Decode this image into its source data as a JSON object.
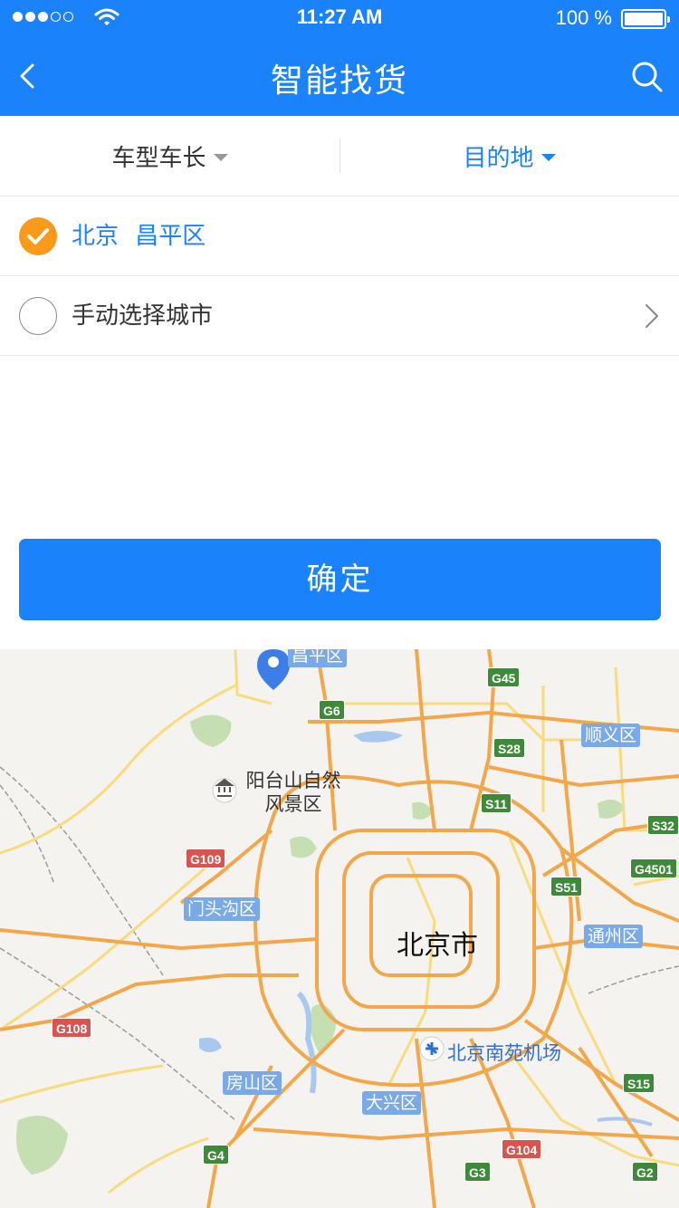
{
  "status_bar": {
    "signal_dots_filled": 3,
    "signal_dots_total": 5,
    "time": "11:27 AM",
    "battery": "100 %",
    "battery_level": 1.0
  },
  "nav": {
    "title": "智能找货",
    "back_icon": "chevron-left-icon",
    "search_icon": "search-icon"
  },
  "filters": {
    "vehicle": "车型车长",
    "destination": "目的地"
  },
  "options": [
    {
      "label": "北京 昌平区",
      "checked": true
    },
    {
      "label": "手动选择城市",
      "checked": false
    }
  ],
  "confirm_label": "确定",
  "map": {
    "districts": [
      "昌平区",
      "顺义区",
      "门头沟区",
      "通州区",
      "房山区",
      "大兴区"
    ],
    "city": "北京市",
    "poi_park": "阳台山自然\n风景区",
    "airport": "北京南苑机场",
    "highways": [
      "G45",
      "G6",
      "S28",
      "S11",
      "S32",
      "G4501",
      "S51",
      "G109",
      "G108",
      "S15",
      "G4",
      "G104",
      "G3",
      "G2"
    ]
  },
  "colors": {
    "primary": "#1a82fb",
    "checked": "#f99a1b",
    "map_bg": "#f4f3ef",
    "road_orange": "#f2a74b",
    "road_yellow": "#f7db7c"
  }
}
